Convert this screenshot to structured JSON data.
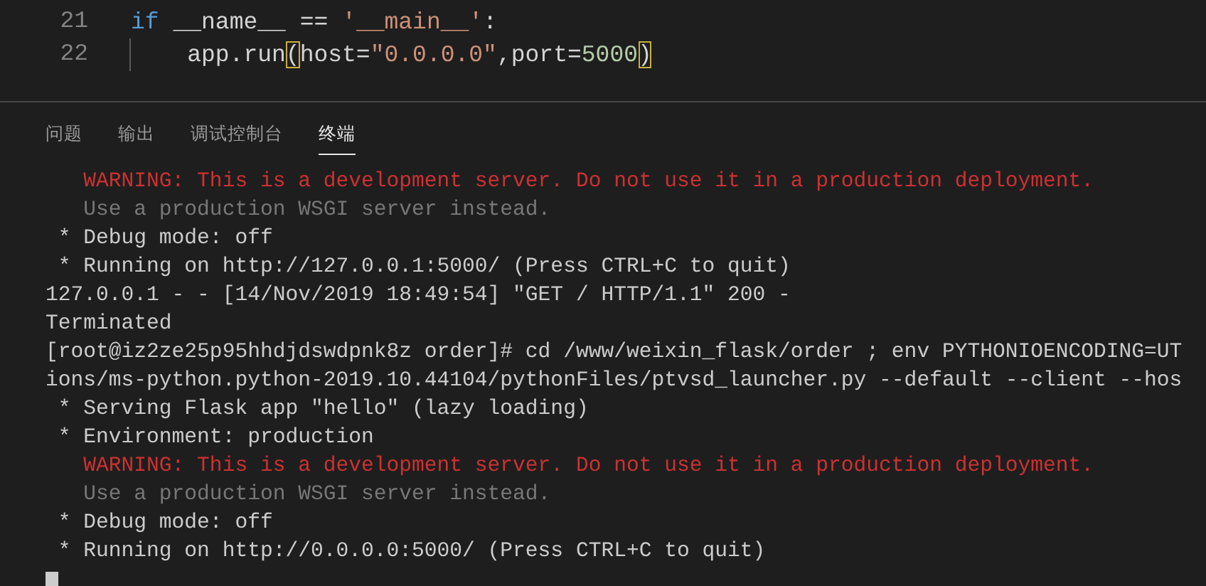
{
  "editor": {
    "lines": [
      {
        "number": "21",
        "indent_guide": false,
        "tokens": [
          {
            "kind": "keyword",
            "text": "if"
          },
          {
            "kind": "plain",
            "text": " __name__ == "
          },
          {
            "kind": "string",
            "text": "'__main__'"
          },
          {
            "kind": "plain",
            "text": ":"
          }
        ]
      },
      {
        "number": "22",
        "indent_guide": true,
        "tokens": [
          {
            "kind": "plain",
            "text": "    app.run"
          },
          {
            "kind": "bracket-match",
            "text": "("
          },
          {
            "kind": "plain",
            "text": "host="
          },
          {
            "kind": "string",
            "text": "\"0.0.0.0\""
          },
          {
            "kind": "plain",
            "text": ",port="
          },
          {
            "kind": "number",
            "text": "5000"
          },
          {
            "kind": "bracket-match",
            "text": ")"
          }
        ]
      }
    ]
  },
  "panel": {
    "tabs": [
      {
        "label": "问题",
        "selected": false
      },
      {
        "label": "输出",
        "selected": false
      },
      {
        "label": "调试控制台",
        "selected": false
      },
      {
        "label": "终端",
        "selected": true
      }
    ],
    "terminal": {
      "lines": [
        {
          "kind": "warning",
          "text": "   WARNING: This is a development server. Do not use it in a production deployment."
        },
        {
          "kind": "dim",
          "text": "   Use a production WSGI server instead."
        },
        {
          "kind": "normal",
          "text": " * Debug mode: off"
        },
        {
          "kind": "normal",
          "text": " * Running on http://127.0.0.1:5000/ (Press CTRL+C to quit)"
        },
        {
          "kind": "normal",
          "text": "127.0.0.1 - - [14/Nov/2019 18:49:54] \"GET / HTTP/1.1\" 200 -"
        },
        {
          "kind": "normal",
          "text": "Terminated"
        },
        {
          "kind": "normal",
          "text": "[root@iz2ze25p95hhdjdswdpnk8z order]# cd /www/weixin_flask/order ; env PYTHONIOENCODING=UT"
        },
        {
          "kind": "normal",
          "text": "ions/ms-python.python-2019.10.44104/pythonFiles/ptvsd_launcher.py --default --client --hos"
        },
        {
          "kind": "normal",
          "text": " * Serving Flask app \"hello\" (lazy loading)"
        },
        {
          "kind": "normal",
          "text": " * Environment: production"
        },
        {
          "kind": "warning",
          "text": "   WARNING: This is a development server. Do not use it in a production deployment."
        },
        {
          "kind": "dim",
          "text": "   Use a production WSGI server instead."
        },
        {
          "kind": "normal",
          "text": " * Debug mode: off"
        },
        {
          "kind": "normal",
          "text": " * Running on http://0.0.0.0:5000/ (Press CTRL+C to quit)"
        }
      ],
      "cursor": true
    }
  }
}
